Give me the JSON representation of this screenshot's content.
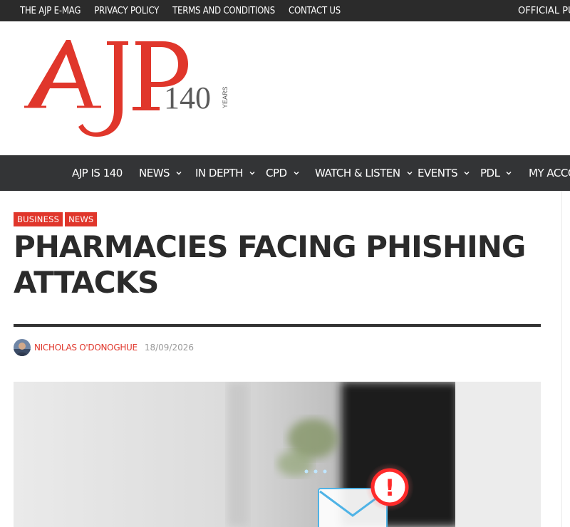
{
  "topbar": {
    "links": [
      "THE AJP E-MAG",
      "PRIVACY POLICY",
      "TERMS AND CONDITIONS",
      "CONTACT US"
    ],
    "right_text": "OFFICIAL PUBLI"
  },
  "logo": {
    "letters": "AJP",
    "number": "140",
    "years": "YEARS",
    "colors": {
      "brand_red": "#e0362b",
      "grey": "#5b5b5b"
    }
  },
  "nav": {
    "items": [
      {
        "label": "AJP IS 140",
        "dropdown": false
      },
      {
        "label": "NEWS",
        "dropdown": true
      },
      {
        "label": "IN DEPTH",
        "dropdown": true
      },
      {
        "label": "CPD",
        "dropdown": true
      },
      {
        "label": "WATCH & LISTEN",
        "dropdown": true
      },
      {
        "label": "EVENTS",
        "dropdown": true
      },
      {
        "label": "PDL",
        "dropdown": true
      },
      {
        "label": "MY ACCOU",
        "dropdown": false
      }
    ]
  },
  "article": {
    "tags": [
      "BUSINESS",
      "NEWS"
    ],
    "title": "PHARMACIES FACING PHISHING ATTACKS",
    "author": "NICHOLAS O'DONOGHUE",
    "date": "18/09/2026",
    "hero_image": {
      "description_icon": "email-alert-icon",
      "alert_glyph": "!"
    }
  },
  "colors": {
    "topbar_bg": "#2b2b2b",
    "nav_bg": "#333436",
    "accent": "#e0362b",
    "text": "#2b2b2b"
  }
}
